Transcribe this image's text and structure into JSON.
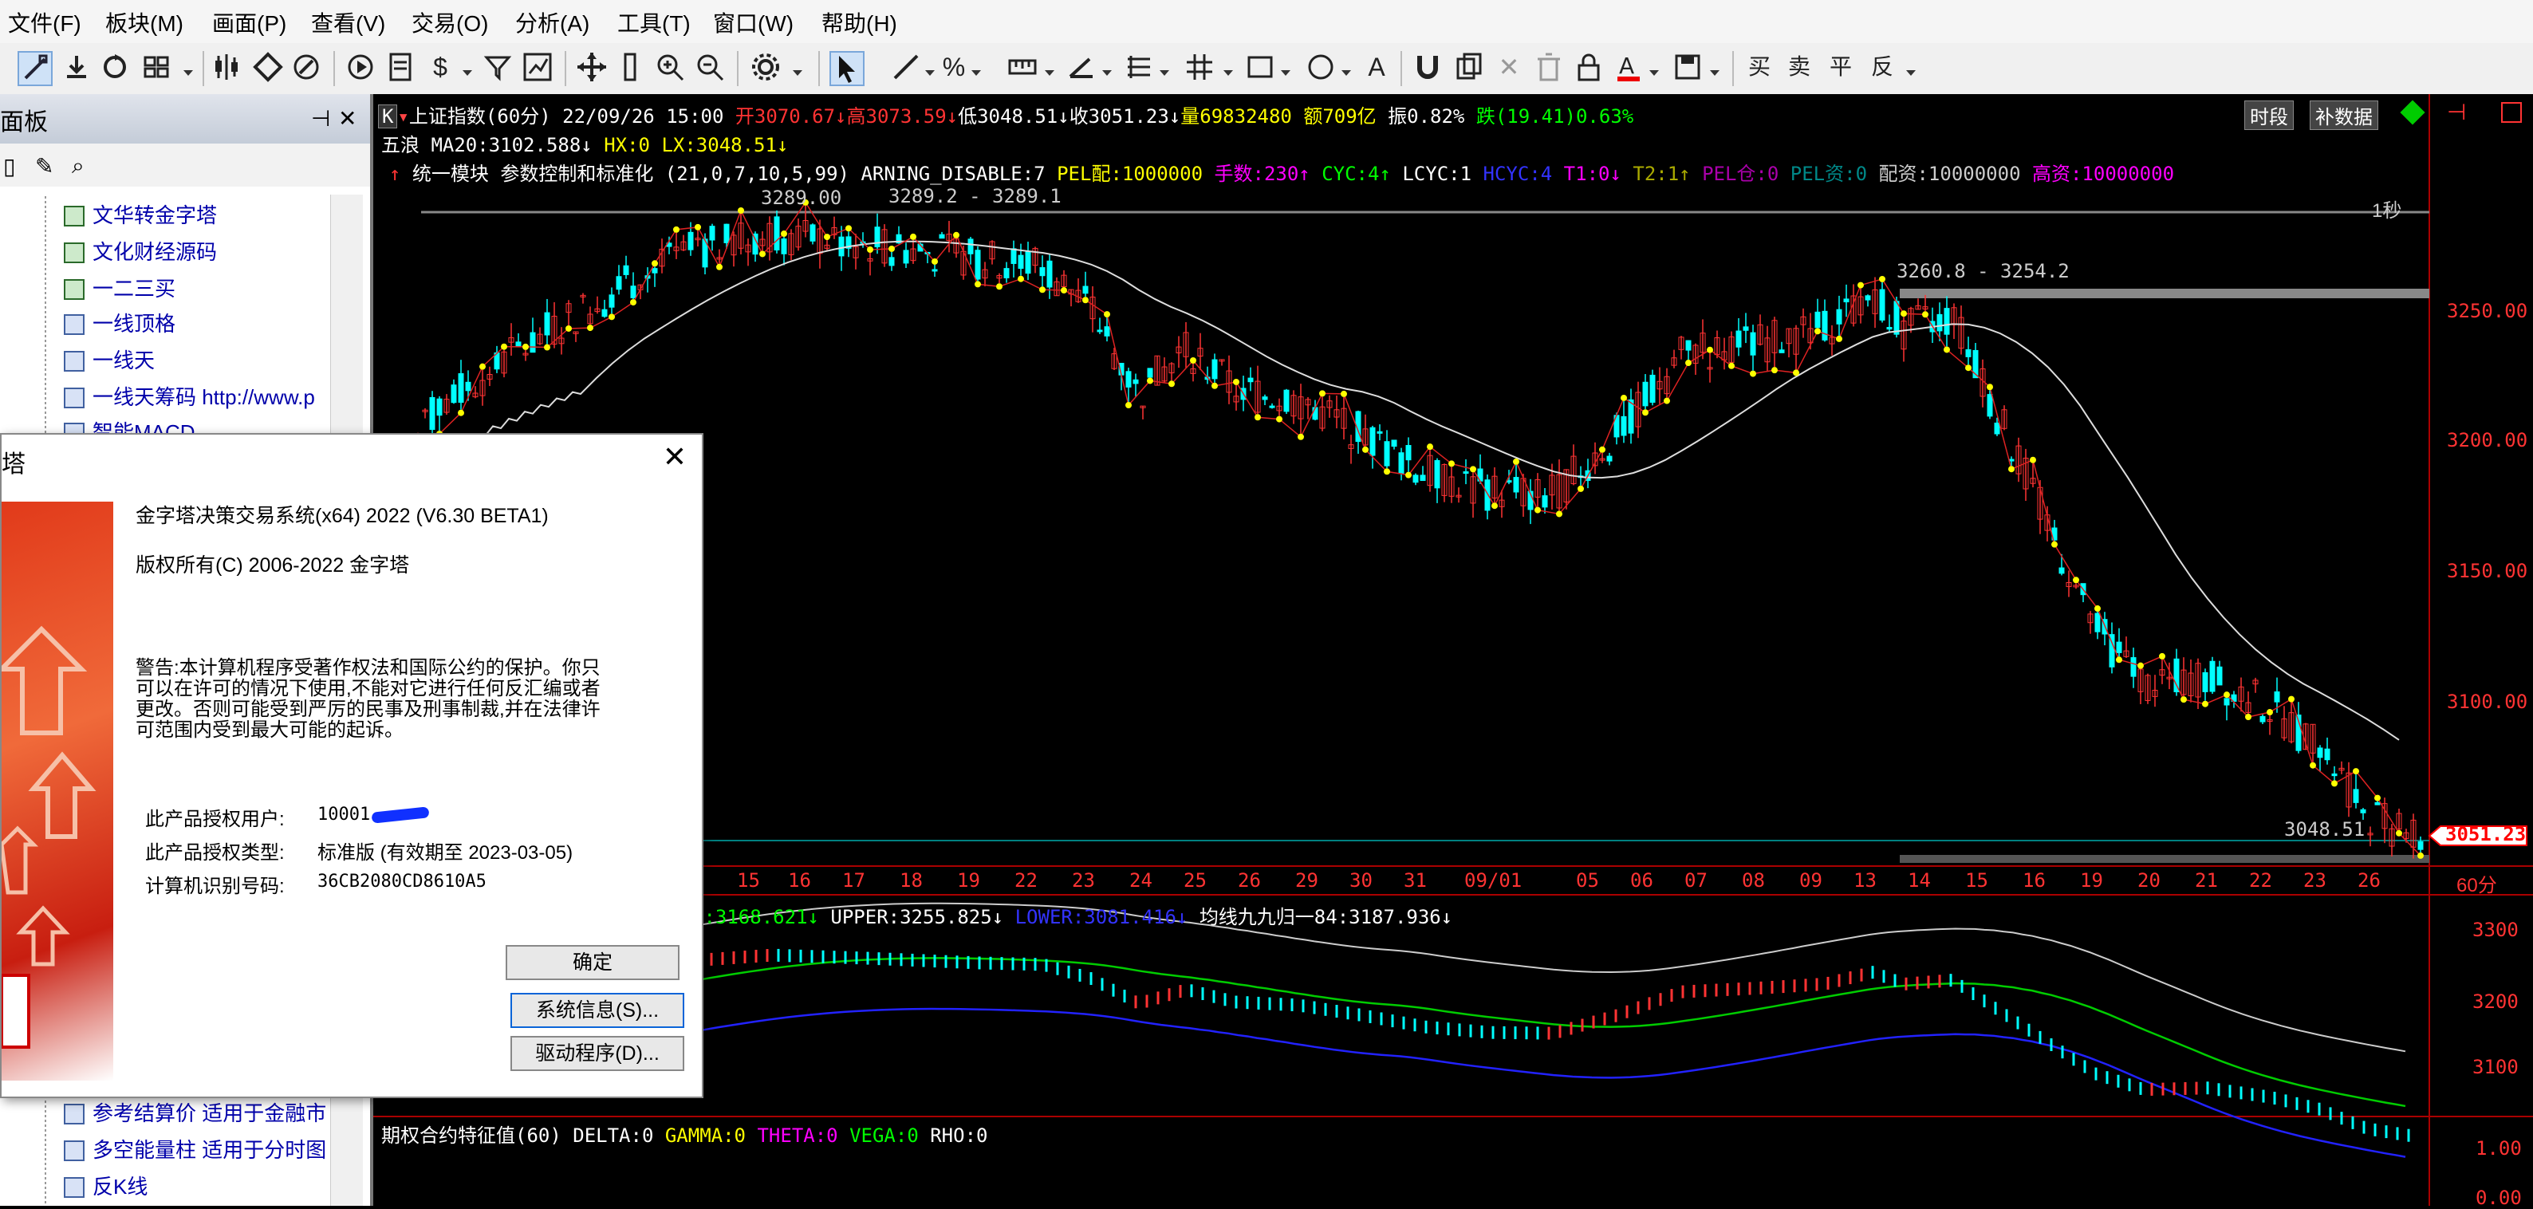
{
  "menubar": {
    "items": [
      "文件(F)",
      "板块(M)",
      "画面(P)",
      "查看(V)",
      "交易(O)",
      "分析(A)",
      "工具(T)",
      "窗口(W)",
      "帮助(H)"
    ]
  },
  "toolbar": {
    "icons": [
      "draw-line-icon",
      "download-icon",
      "refresh-icon",
      "layout-icon",
      "kline-icon",
      "diamond-icon",
      "edit-icon",
      "play-icon",
      "document-icon",
      "dollar-icon",
      "filter-icon",
      "chart-icon",
      "move-icon",
      "column-icon",
      "zoom-in-icon",
      "zoom-out-icon",
      "gear-icon",
      "pointer-icon",
      "line-tool-icon",
      "percent-icon",
      "ruler-icon",
      "angle-icon",
      "parallel-icon",
      "grid-icon",
      "rectangle-icon",
      "circle-icon",
      "text-icon",
      "magnet-icon",
      "copy-icon",
      "delete-icon",
      "trash-icon",
      "lock-icon",
      "font-color-icon",
      "save-icon"
    ],
    "trade_buttons": [
      "买",
      "卖",
      "平",
      "反"
    ]
  },
  "left_panel": {
    "title": "面板",
    "pin_icon": "pin-icon",
    "close_icon": "close-icon",
    "tree_items_top": [
      "文华转金字塔",
      "文化财经源码",
      "一二三买",
      "一线顶格",
      "一线天",
      "一线天筹码 http://www.p",
      "智能MACD"
    ],
    "tree_items_bottom": [
      "参考结算价 适用于金融市",
      "多空能量柱 适用于分时图",
      "反K线"
    ]
  },
  "chart": {
    "header": {
      "symbol": "上证指数(60分)",
      "datetime": "22/09/26 15:00",
      "open": "开3070.67↓",
      "high": "高3073.59↓",
      "low": "低3048.51↓",
      "close": "收3051.23↓",
      "volume": "量69832480",
      "amount": "额709亿",
      "amplitude": "振0.82%",
      "change": "跌(19.41)0.63%",
      "btn_period": "时段",
      "btn_rights": "补数据"
    },
    "line2": {
      "wave": "五浪",
      "ma": "MA20:3102.588↓",
      "hx": "HX:0",
      "lx": "LX:3048.51↓"
    },
    "line3": {
      "arrow": "↑",
      "name": "统一模块",
      "params": "参数控制和标准化 (21,0,7,10,5,99) ARNING_DISABLE:7",
      "pel": "PEL配:1000000",
      "shoushu": "手数:230↑",
      "cyc": "CYC:4↑",
      "lcyc": "LCYC:1",
      "hcyc": "HCYC:4",
      "t1": "T1:0↓",
      "t2": "T2:1↑",
      "pelcang": "PEL仓:0",
      "pelzi": "PEL资:0",
      "peizi": "配资:10000000",
      "gaozi": "高资:10000000"
    },
    "annotations": {
      "top_label": "3289.2 - 3289.1",
      "top_left_label": "3289.00",
      "mid_label": "3260.8 - 3254.2",
      "low_label": "3048.51",
      "second_label": "1秒"
    },
    "price_axis": [
      "3250.00",
      "3200.00",
      "3150.00",
      "3100.00"
    ],
    "last_price": "3051.23",
    "date_axis": [
      "15",
      "16",
      "17",
      "18",
      "19",
      "22",
      "23",
      "24",
      "25",
      "26",
      "29",
      "30",
      "31",
      "09/01",
      "05",
      "06",
      "07",
      "08",
      "09",
      "13",
      "14",
      "15",
      "16",
      "19",
      "20",
      "21",
      "22",
      "23",
      "26"
    ],
    "period_label": "60分",
    "boll": {
      "mid": "D:3168.621↓",
      "upper": "UPPER:3255.825↓",
      "lower": "LOWER:3081.416↓",
      "ma84": "均线九九归一84:3187.936↓"
    },
    "boll_axis": [
      "3300",
      "3200",
      "3100"
    ],
    "option_line": {
      "name": "期权合约特征值(60)",
      "delta": "DELTA:0",
      "gamma": "GAMMA:0",
      "theta": "THETA:0",
      "vega": "VEGA:0",
      "rho": "RHO:0"
    },
    "option_axis": [
      "1.00",
      "0.00"
    ]
  },
  "dialog": {
    "title": "塔",
    "product": "金字塔决策交易系统(x64) 2022 (V6.30 BETA1)",
    "copyright": "版权所有(C) 2006-2022 金字塔",
    "warning": [
      "警告:本计算机程序受著作权法和国际公约的保护。你只",
      "可以在许可的情况下使用,不能对它进行任何反汇编或者",
      "更改。否则可能受到严厉的民事及刑事制裁,并在法律许",
      "可范围内受到最大可能的起诉。"
    ],
    "user_label": "此产品授权用户:",
    "user_value": "10001",
    "type_label": "此产品授权类型:",
    "type_value": "标准版 (有效期至 2023-03-05)",
    "machine_label": "计算机识别号码:",
    "machine_value": "36CB2080CD8610A5",
    "btn_ok": "确定",
    "btn_sysinfo": "系统信息(S)...",
    "btn_driver": "驱动程序(D)..."
  }
}
